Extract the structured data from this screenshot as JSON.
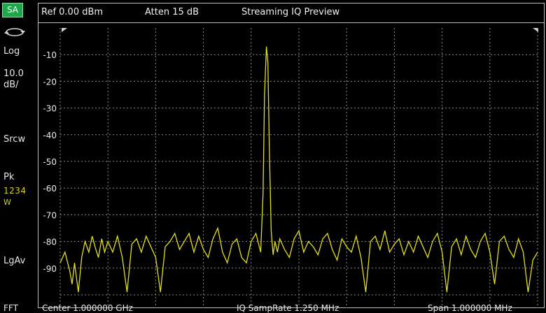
{
  "header": {
    "mode": "SA",
    "ref_level": "Ref 0.00 dBm",
    "attenuation": "Atten 15 dB",
    "view_title": "Streaming IQ Preview"
  },
  "side_panel": {
    "sync_icon": "sync-arrows-icon",
    "scale_type": "Log",
    "scale_per_div": "10.0\ndB/",
    "source": "Srcw",
    "detector": "Pk",
    "traces": "1234",
    "trace_mode": "W",
    "averaging": "LgAv"
  },
  "footer": {
    "fft": "FFT",
    "center": "Center 1.000000 GHz",
    "sample_rate": "IQ SampRate 1.250 MHz",
    "span": "Span 1.000000 MHz"
  },
  "colors": {
    "trace": "#e3df1a",
    "grid": "#8a8a8a",
    "mode_badge": "#1fa64a",
    "background": "#000000"
  },
  "chart_data": {
    "type": "line",
    "xlim": [
      0,
      1
    ],
    "ylim": [
      -100,
      0
    ],
    "y_ticks": [
      -10,
      -20,
      -30,
      -40,
      -50,
      -60,
      -70,
      -80,
      -90
    ],
    "x_divisions": 10,
    "y_divisions": 10,
    "grid": true,
    "series": [
      {
        "x": [
          0.0,
          0.01,
          0.02,
          0.025,
          0.03,
          0.038,
          0.045,
          0.052,
          0.06,
          0.067,
          0.073,
          0.08,
          0.087,
          0.093,
          0.1,
          0.11,
          0.12,
          0.13,
          0.14,
          0.15,
          0.16,
          0.17,
          0.18,
          0.19,
          0.2,
          0.21,
          0.22,
          0.23,
          0.24,
          0.25,
          0.26,
          0.27,
          0.28,
          0.29,
          0.3,
          0.31,
          0.32,
          0.33,
          0.34,
          0.35,
          0.36,
          0.37,
          0.38,
          0.39,
          0.4,
          0.41,
          0.42,
          0.425,
          0.428,
          0.432,
          0.435,
          0.438,
          0.442,
          0.446,
          0.45,
          0.455,
          0.46,
          0.47,
          0.48,
          0.49,
          0.5,
          0.51,
          0.52,
          0.53,
          0.54,
          0.55,
          0.56,
          0.57,
          0.58,
          0.59,
          0.6,
          0.61,
          0.62,
          0.63,
          0.64,
          0.65,
          0.66,
          0.67,
          0.68,
          0.69,
          0.7,
          0.71,
          0.72,
          0.73,
          0.74,
          0.75,
          0.76,
          0.77,
          0.78,
          0.79,
          0.8,
          0.81,
          0.82,
          0.83,
          0.84,
          0.85,
          0.86,
          0.87,
          0.88,
          0.89,
          0.9,
          0.91,
          0.92,
          0.93,
          0.94,
          0.95,
          0.96,
          0.97,
          0.98,
          0.99,
          1.0
        ],
        "y": [
          -88,
          -84,
          -91,
          -96,
          -88,
          -99,
          -86,
          -80,
          -84,
          -78,
          -82,
          -86,
          -79,
          -84,
          -80,
          -84,
          -78,
          -86,
          -99,
          -81,
          -79,
          -84,
          -78,
          -82,
          -86,
          -99,
          -82,
          -80,
          -77,
          -83,
          -80,
          -77,
          -84,
          -78,
          -83,
          -86,
          -79,
          -75,
          -84,
          -88,
          -81,
          -79,
          -86,
          -88,
          -80,
          -77,
          -84,
          -62,
          -25,
          -7,
          -13,
          -44,
          -76,
          -85,
          -80,
          -84,
          -79,
          -83,
          -86,
          -79,
          -76,
          -84,
          -80,
          -82,
          -85,
          -79,
          -77,
          -83,
          -87,
          -79,
          -82,
          -84,
          -78,
          -86,
          -99,
          -80,
          -78,
          -83,
          -76,
          -84,
          -81,
          -79,
          -85,
          -80,
          -84,
          -78,
          -82,
          -86,
          -80,
          -77,
          -84,
          -99,
          -82,
          -79,
          -85,
          -78,
          -83,
          -86,
          -80,
          -77,
          -84,
          -96,
          -80,
          -78,
          -83,
          -86,
          -79,
          -84,
          -99,
          -87,
          -84
        ]
      }
    ]
  }
}
